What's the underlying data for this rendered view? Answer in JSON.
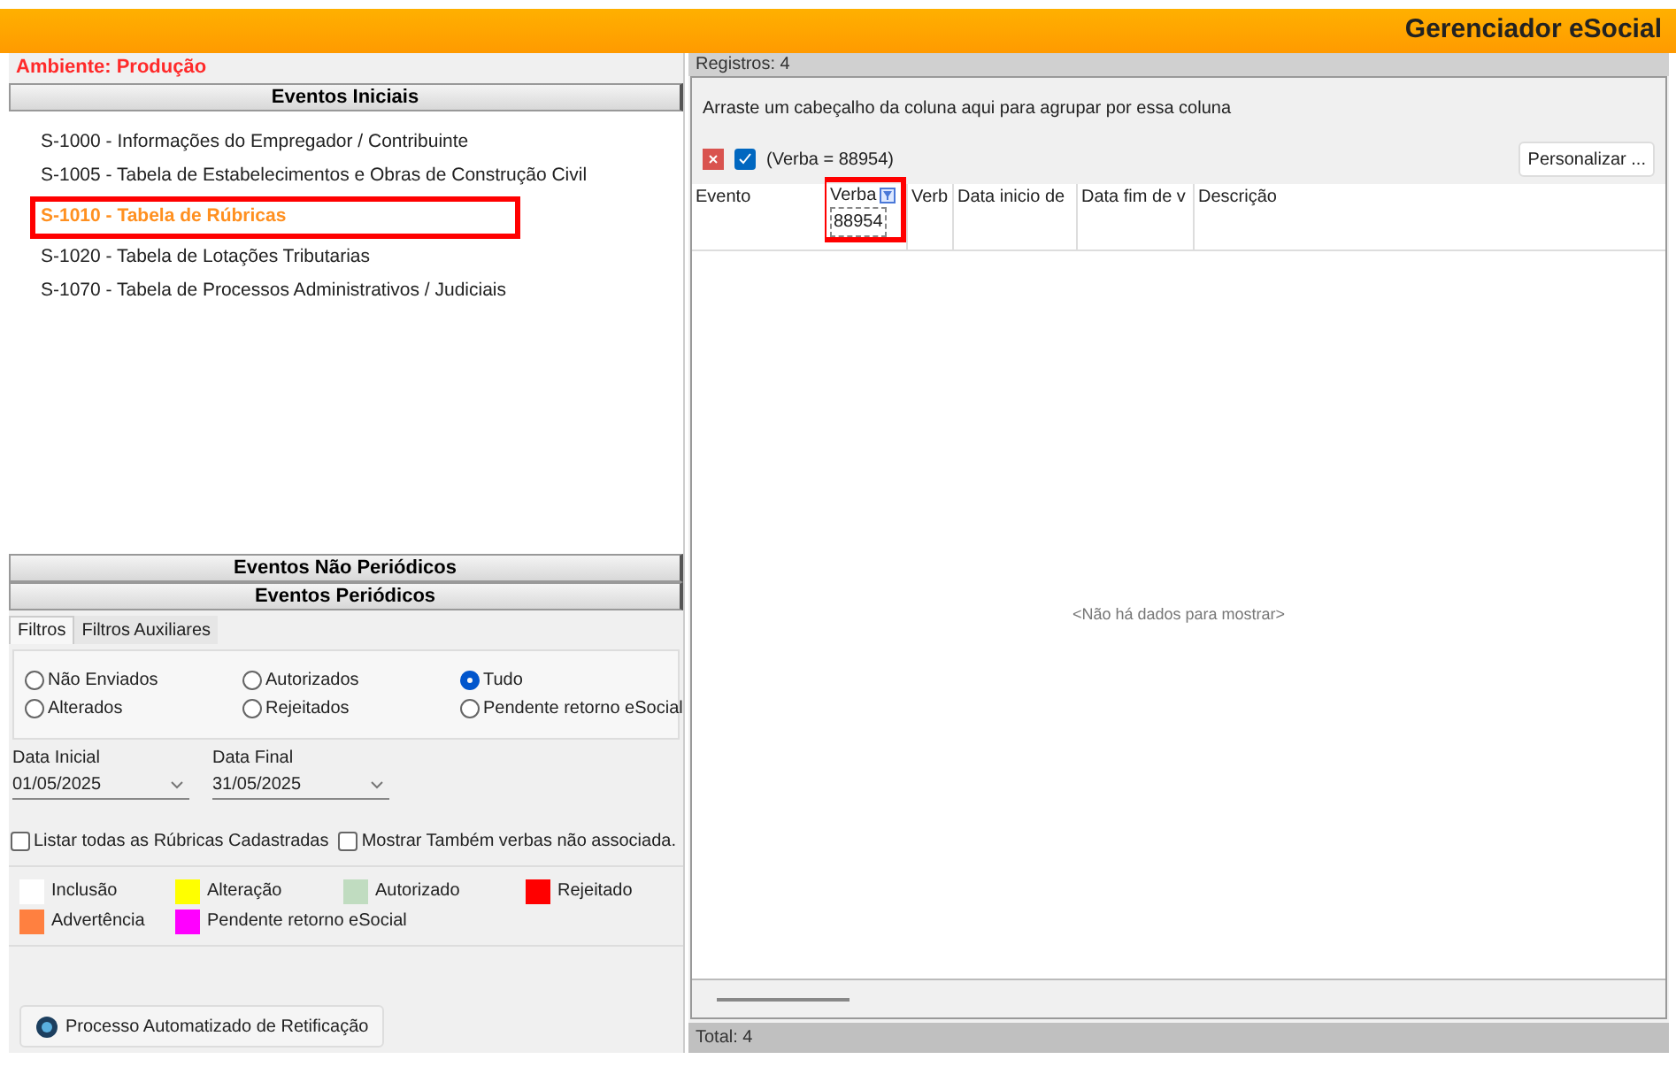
{
  "header": {
    "title": "Gerenciador eSocial"
  },
  "environment": "Ambiente: Produção",
  "sections": [
    {
      "title": "Eventos Iniciais",
      "items": [
        {
          "label": "S-1000 - Informações do Empregador / Contribuinte",
          "selected": false,
          "highlighted": false
        },
        {
          "label": "S-1005 - Tabela de Estabelecimentos e Obras de Construção Civil",
          "selected": false,
          "highlighted": false
        },
        {
          "label": "S-1010 - Tabela de Rúbricas",
          "selected": true,
          "highlighted": true
        },
        {
          "label": "S-1020 - Tabela de Lotações Tributarias",
          "selected": false,
          "highlighted": false
        },
        {
          "label": "S-1070 - Tabela de Processos Administrativos / Judiciais",
          "selected": false,
          "highlighted": false
        }
      ]
    },
    {
      "title": "Eventos Não Periódicos"
    },
    {
      "title": "Eventos Periódicos"
    }
  ],
  "filter_tabs": [
    {
      "label": "Filtros",
      "selected": true
    },
    {
      "label": "Filtros Auxiliares",
      "selected": false
    }
  ],
  "status_radios": [
    {
      "label": "Não Enviados",
      "selected": false
    },
    {
      "label": "Autorizados",
      "selected": false
    },
    {
      "label": "Tudo",
      "selected": true
    },
    {
      "label": "Alterados",
      "selected": false
    },
    {
      "label": "Rejeitados",
      "selected": false
    },
    {
      "label": "Pendente retorno eSocial",
      "selected": false
    }
  ],
  "dates": [
    {
      "label": "Data Inicial",
      "value": "01/05/2025"
    },
    {
      "label": "Data Final",
      "value": "31/05/2025"
    }
  ],
  "checkboxes": [
    {
      "label": "Listar todas as Rúbricas Cadastradas",
      "checked": false
    },
    {
      "label": "Mostrar Também verbas não associada.",
      "checked": false
    }
  ],
  "legend": [
    {
      "label": "Inclusão",
      "color": "#ffffff"
    },
    {
      "label": "Alteração",
      "color": "#ffff00"
    },
    {
      "label": "Autorizado",
      "color": "#c0dcc0"
    },
    {
      "label": "Rejeitado",
      "color": "#ff0000"
    },
    {
      "label": "Advertência",
      "color": "#ff8040"
    },
    {
      "label": "Pendente retorno eSocial",
      "color": "#ff00ff"
    }
  ],
  "action_button": "Processo Automatizado de Retificação",
  "grid": {
    "records": "Registros: 4",
    "group_hint": "Arraste um cabeçalho da coluna aqui para agrupar por essa coluna",
    "filter": {
      "enabled": true,
      "text": "(Verba = 88954)"
    },
    "customize_button": "Personalizar ...",
    "columns": [
      {
        "label": "Evento",
        "filtered": false,
        "highlighted": false
      },
      {
        "label": "Verba",
        "filtered": true,
        "filter_value": "88954",
        "highlighted": true
      },
      {
        "label": "Verb",
        "filtered": false,
        "highlighted": false
      },
      {
        "label": "Data inicio de",
        "filtered": false,
        "highlighted": false
      },
      {
        "label": "Data fim de v",
        "filtered": false,
        "highlighted": false
      },
      {
        "label": "Descrição",
        "filtered": false,
        "highlighted": false
      }
    ],
    "empty_text": "<Não há dados para mostrar>",
    "total": "Total: 4"
  }
}
